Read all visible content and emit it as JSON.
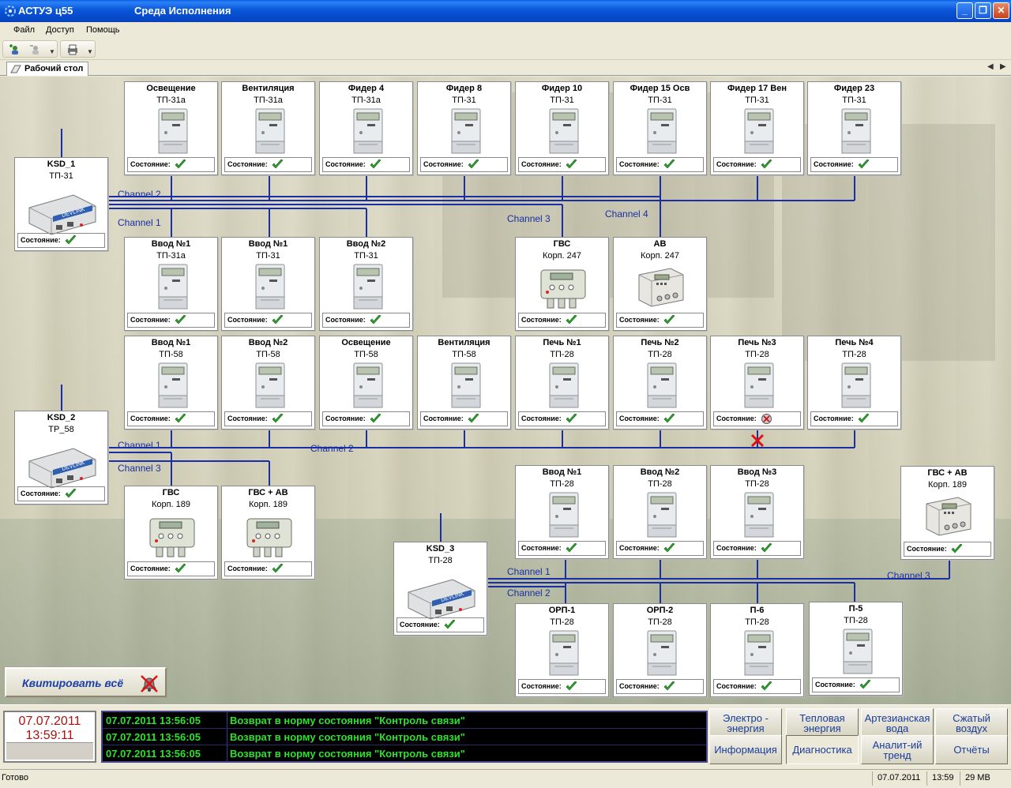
{
  "window": {
    "app_name": "АСТУЭ ц55",
    "title": "Среда Исполнения"
  },
  "menu": [
    "Файл",
    "Доступ",
    "Помощь"
  ],
  "tab": {
    "label": "Рабочий стол"
  },
  "status_prefix": "Состояние:",
  "ksd": [
    {
      "name": "KSD_1",
      "sub": "ТП-31",
      "status": "ok"
    },
    {
      "name": "KSD_2",
      "sub": "TP_58",
      "status": "ok"
    },
    {
      "name": "KSD_3",
      "sub": "ТП-28",
      "status": "ok"
    }
  ],
  "meters": [
    {
      "name": "Освещение",
      "sub": "ТП-31а",
      "type": "meter",
      "status": "ok"
    },
    {
      "name": "Вентиляция",
      "sub": "ТП-31а",
      "type": "meter",
      "status": "ok"
    },
    {
      "name": "Фидер 4",
      "sub": "ТП-31а",
      "type": "meter",
      "status": "ok"
    },
    {
      "name": "Фидер 8",
      "sub": "ТП-31",
      "type": "meter",
      "status": "ok"
    },
    {
      "name": "Фидер 10",
      "sub": "ТП-31",
      "type": "meter",
      "status": "ok"
    },
    {
      "name": "Фидер 15 Осв",
      "sub": "ТП-31",
      "type": "meter",
      "status": "ok"
    },
    {
      "name": "Фидер 17 Вен",
      "sub": "ТП-31",
      "type": "meter",
      "status": "ok"
    },
    {
      "name": "Фидер 23",
      "sub": "ТП-31",
      "type": "meter",
      "status": "ok"
    },
    {
      "name": "Ввод №1",
      "sub": "ТП-31а",
      "type": "meter",
      "status": "ok"
    },
    {
      "name": "Ввод №1",
      "sub": "ТП-31",
      "type": "meter",
      "status": "ok"
    },
    {
      "name": "Ввод №2",
      "sub": "ТП-31",
      "type": "meter",
      "status": "ok"
    },
    {
      "name": "ГВС",
      "sub": "Корп. 247",
      "type": "heat",
      "status": "ok"
    },
    {
      "name": "АВ",
      "sub": "Корп. 247",
      "type": "box",
      "status": "ok"
    },
    {
      "name": "Ввод №1",
      "sub": "ТП-58",
      "type": "meter",
      "status": "ok"
    },
    {
      "name": "Ввод №2",
      "sub": "ТП-58",
      "type": "meter",
      "status": "ok"
    },
    {
      "name": "Освещение",
      "sub": "ТП-58",
      "type": "meter",
      "status": "ok"
    },
    {
      "name": "Вентиляция",
      "sub": "ТП-58",
      "type": "meter",
      "status": "ok"
    },
    {
      "name": "Печь №1",
      "sub": "ТП-28",
      "type": "meter",
      "status": "ok"
    },
    {
      "name": "Печь №2",
      "sub": "ТП-28",
      "type": "meter",
      "status": "ok"
    },
    {
      "name": "Печь №3",
      "sub": "ТП-28",
      "type": "meter",
      "status": "error"
    },
    {
      "name": "Печь №4",
      "sub": "ТП-28",
      "type": "meter",
      "status": "ok"
    },
    {
      "name": "ГВС",
      "sub": "Корп. 189",
      "type": "heat",
      "status": "ok"
    },
    {
      "name": "ГВС + АВ",
      "sub": "Корп. 189",
      "type": "heat",
      "status": "ok"
    },
    {
      "name": "Ввод №1",
      "sub": "ТП-28",
      "type": "meter",
      "status": "ok"
    },
    {
      "name": "Ввод №2",
      "sub": "ТП-28",
      "type": "meter",
      "status": "ok"
    },
    {
      "name": "Ввод №3",
      "sub": "ТП-28",
      "type": "meter",
      "status": "ok"
    },
    {
      "name": "ГВС + АВ",
      "sub": "Корп. 189",
      "type": "box",
      "status": "ok"
    },
    {
      "name": "ОРП-1",
      "sub": "ТП-28",
      "type": "meter",
      "status": "ok"
    },
    {
      "name": "ОРП-2",
      "sub": "ТП-28",
      "type": "meter",
      "status": "ok"
    },
    {
      "name": "П-6",
      "sub": "ТП-28",
      "type": "meter",
      "status": "ok"
    },
    {
      "name": "П-5",
      "sub": "ТП-28",
      "type": "meter",
      "status": "ok"
    }
  ],
  "channels": [
    "Channel 2",
    "Channel 1",
    "Channel 3",
    "Channel 4",
    "Channel 1",
    "Channel 2",
    "Channel 3",
    "Channel 1",
    "Channel 2",
    "Channel 3"
  ],
  "ack_button": {
    "label": "Квитировать всё"
  },
  "clock": {
    "date": "07.07.2011",
    "time": "13:59:11"
  },
  "events": [
    {
      "datetime": "07.07.2011 13:56:05",
      "message": "Возврат в норму состояния \"Контроль связи\""
    },
    {
      "datetime": "07.07.2011 13:56:05",
      "message": "Возврат в норму состояния \"Контроль связи\""
    },
    {
      "datetime": "07.07.2011 13:56:05",
      "message": "Возврат в норму состояния \"Контроль связи\""
    }
  ],
  "nav": {
    "electro": "Электро - энергия",
    "heat": "Тепловая энергия",
    "artesian": "Артезианская вода",
    "air": "Сжатый воздух",
    "info": "Информация",
    "diag": "Диагностика",
    "trend": "Аналит-ий тренд",
    "reports": "Отчёты"
  },
  "statusbar": {
    "ready": "Готово",
    "date": "07.07.2011",
    "time": "13:59",
    "memory": "29 MB"
  },
  "colors": {
    "ok": "#2aa52a",
    "error": "#d01010",
    "bus": "#1a2fa6",
    "event_text": "#2fe02f"
  }
}
